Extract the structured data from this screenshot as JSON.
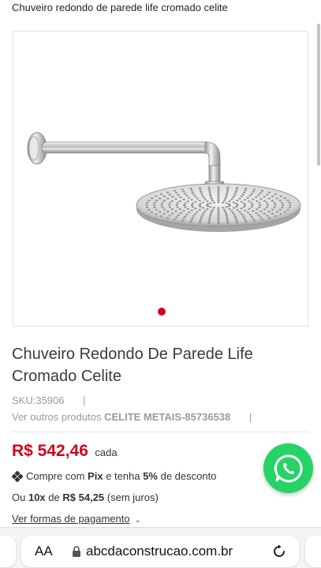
{
  "breadcrumb": "Chuveiro redondo de parede life cromado celite",
  "product": {
    "title": "Chuveiro Redondo De Parede Life Cromado Celite",
    "sku": "SKU:35906",
    "separator": "|",
    "see_more_prefix": "Ver outros produtos",
    "brand": "CELITE METAIS-85736538"
  },
  "gallery": {
    "active_slide": 1,
    "slides": 1,
    "image_icon": "shower-head-image",
    "accent_color": "#d0021b"
  },
  "pricing": {
    "price": "R$ 542,46",
    "unit": "cada",
    "pix_prefix": "Compre com",
    "pix_label": "Pix",
    "pix_middle": "e tenha",
    "pix_discount": "5%",
    "pix_suffix": "de desconto",
    "installment_prefix": "Ou",
    "installment_count": "10x",
    "installment_middle": "de",
    "installment_value": "R$ 54,25",
    "installment_suffix": "(sem juros)",
    "payment_link": "Ver formas de pagamento",
    "price_color": "#d0021b"
  },
  "whatsapp": {
    "icon": "whatsapp-icon",
    "color": "#25d366"
  },
  "browser": {
    "text_size_label": "AA",
    "url": "abcdaconstrucao.com.br",
    "lock_icon": "lock-icon",
    "reload_icon": "reload-icon"
  }
}
